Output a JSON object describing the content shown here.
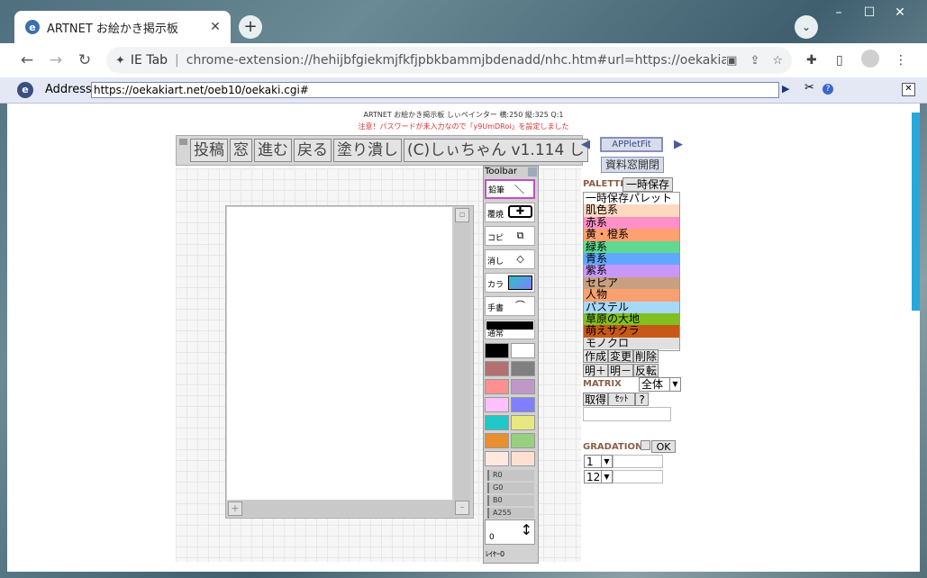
{
  "browser": {
    "tab_title": "ARTNET お絵かき掲示板",
    "tab_icon": "e",
    "close_glyph": "✕",
    "new_tab_glyph": "+",
    "tab_search_glyph": "⌄",
    "window_controls": [
      "–",
      "☐",
      "✕"
    ],
    "nav": {
      "back": "←",
      "forward": "→",
      "reload": "↻"
    },
    "omnibox": {
      "ext_label": "IE Tab",
      "separator": "|",
      "url": "chrome-extension://hehijbfgiekmjfkfjpbkbammjbdenadd/nhc.htm#url=https://oekakiart.net/oeb1…"
    },
    "toolbar_icons": [
      "translate-icon",
      "share-icon",
      "star-icon",
      "extensions-icon",
      "sidepanel-icon",
      "profile-icon",
      "menu-icon"
    ],
    "menu_glyph": "⋮"
  },
  "ietab": {
    "logo": "e",
    "address_label": "Address:",
    "address_value": "https://oekakiart.net/oeb10/oekaki.cgi#",
    "go_glyph": "▶",
    "tools_glyph": "✂",
    "help_glyph": "?",
    "close_glyph": "✕"
  },
  "page": {
    "header_info": "ARTNET お絵かき掲示板 しぃペインター 横:250 縦:325 Q:1",
    "warning": "注意！パスワードが未入力なので「y9UmDRoi」を設定しました",
    "top_buttons": [
      "投稿",
      "窓",
      "進む",
      "戻る",
      "塗り潰し",
      "(C)しぃちゃん v1.114 し"
    ],
    "canvas": {
      "width": 250,
      "height": 325
    }
  },
  "toolpanel": {
    "title": "Toolbar",
    "tools": [
      {
        "label": "鉛筆",
        "icon": "pencil-icon",
        "selected": true
      },
      {
        "label": "覆焼",
        "icon": "dodge-icon",
        "selected": false
      },
      {
        "label": "コピ",
        "icon": "copy-icon",
        "selected": false
      },
      {
        "label": "消し",
        "icon": "eraser-icon",
        "selected": false
      },
      {
        "label": "カラ",
        "icon": "gradient-icon",
        "selected": false
      },
      {
        "label": "手書",
        "icon": "freehand-icon",
        "selected": false
      }
    ],
    "mode_label": "通常",
    "swatches": [
      "#000000",
      "#ffffff",
      "#b47070",
      "#808080",
      "#ff9090",
      "#c098c8",
      "#ffc0ff",
      "#8080ff",
      "#20c8c8",
      "#e8e880",
      "#e89030",
      "#98d080",
      "#ffe8e0",
      "#ffe0d0"
    ],
    "sliders": [
      "R0",
      "G0",
      "B0",
      "A255"
    ],
    "size_value": "0",
    "size_glyph": "↕",
    "layer_label": "ﾚｲﾔｰ0"
  },
  "palette": {
    "arrow_left": "◀",
    "arrow_right": "▶",
    "appletfit_label": "APPletFit",
    "shiryo_label": "資料窓開閉",
    "title": "PALETTE",
    "save_temp_btn": "一時保存",
    "items": [
      {
        "label": "一時保存パレット",
        "color": "#ffffff"
      },
      {
        "label": "肌色系",
        "color": "#ffd8c0"
      },
      {
        "label": "赤系",
        "color": "#ff90c8"
      },
      {
        "label": "黄・橙系",
        "color": "#ffa070"
      },
      {
        "label": "緑系",
        "color": "#60d890"
      },
      {
        "label": "青系",
        "color": "#60a8ff"
      },
      {
        "label": "紫系",
        "color": "#c898f8"
      },
      {
        "label": "セピア",
        "color": "#c8a080"
      },
      {
        "label": "人物",
        "color": "#f8a070"
      },
      {
        "label": "パステル",
        "color": "#a8d8f8"
      },
      {
        "label": "草原の大地",
        "color": "#80c020"
      },
      {
        "label": "萌えサクラ",
        "color": "#c85818"
      },
      {
        "label": "モノクロ",
        "color": "#e0e0e0"
      }
    ],
    "row1": [
      "作成",
      "変更",
      "削除"
    ],
    "row2": [
      "明＋",
      "明－",
      "反転"
    ],
    "matrix_title": "MATRIX",
    "matrix_select": "全体",
    "matrix_row": [
      "取得",
      "ｾｯﾄ",
      "?"
    ],
    "gradation_title": "GRADATION",
    "ok_label": "OK",
    "grad_select1": "1",
    "grad_select2": "12"
  }
}
